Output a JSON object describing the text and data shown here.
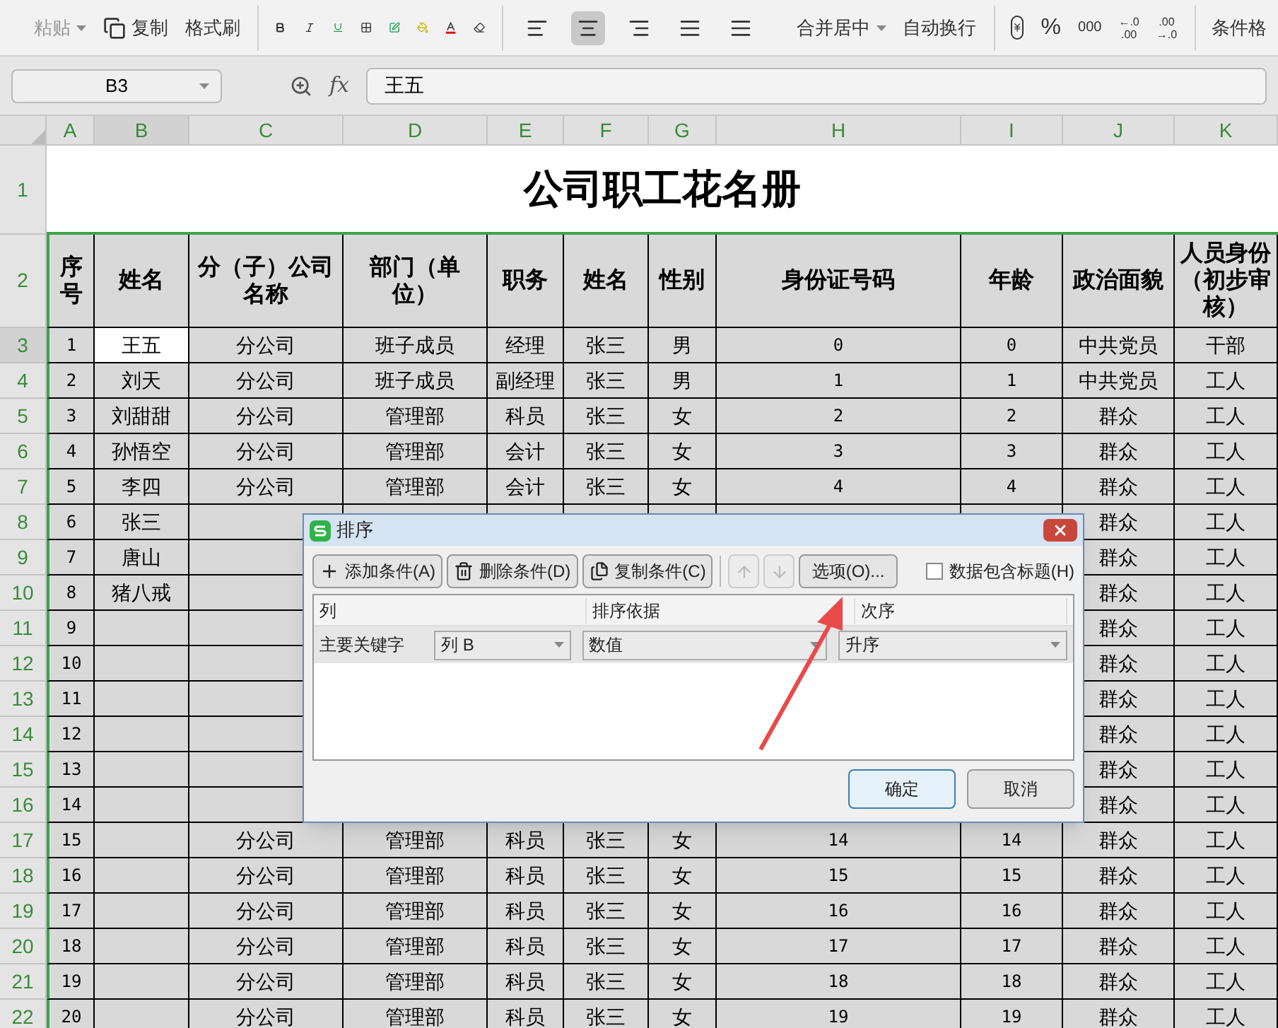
{
  "ribbon": {
    "paste": "粘贴",
    "copy": "复制",
    "format_painter": "格式刷",
    "alignment": [
      {
        "kind": "left",
        "selected": false
      },
      {
        "kind": "center",
        "selected": true
      },
      {
        "kind": "right",
        "selected": false
      },
      {
        "kind": "justify",
        "selected": false
      },
      {
        "kind": "distributed",
        "selected": false
      }
    ],
    "merge": "合并居中",
    "wrap": "自动换行",
    "percent": "%",
    "thousands": "000",
    "decimals": [
      [
        "←.0",
        ".00"
      ],
      [
        ".00",
        "→.0"
      ]
    ],
    "conditional": "条件格"
  },
  "formula_bar": {
    "cell": "B3",
    "fx": "fx",
    "value": "王五"
  },
  "columns": [
    {
      "label": "A",
      "selected": false
    },
    {
      "label": "B",
      "selected": true
    },
    {
      "label": "C",
      "selected": false
    },
    {
      "label": "D",
      "selected": false
    },
    {
      "label": "E",
      "selected": false
    },
    {
      "label": "F",
      "selected": false
    },
    {
      "label": "G",
      "selected": false
    },
    {
      "label": "H",
      "selected": false
    },
    {
      "label": "I",
      "selected": false
    },
    {
      "label": "J",
      "selected": false
    },
    {
      "label": "K",
      "selected": false
    }
  ],
  "title_row": {
    "row": "1",
    "title": "公司职工花名册"
  },
  "header_row": {
    "row": "2",
    "cells": {
      "A": "序号",
      "B": "姓名",
      "C": "分（子）公司名称",
      "D": "部门（单位）",
      "E": "职务",
      "F": "姓名",
      "G": "性别",
      "H": "身份证号码",
      "I": "年龄",
      "J": "政治面貌",
      "K": "人员身份（初步审核）"
    }
  },
  "rows": [
    {
      "row": "3",
      "selected": true,
      "cells": {
        "A": "1",
        "B": "王五",
        "C": "分公司",
        "D": "班子成员",
        "E": "经理",
        "F": "张三",
        "G": "男",
        "H": "0",
        "I": "0",
        "J": "中共党员",
        "K": "干部"
      }
    },
    {
      "row": "4",
      "selected": false,
      "cells": {
        "A": "2",
        "B": "刘天",
        "C": "分公司",
        "D": "班子成员",
        "E": "副经理",
        "F": "张三",
        "G": "男",
        "H": "1",
        "I": "1",
        "J": "中共党员",
        "K": "工人"
      }
    },
    {
      "row": "5",
      "selected": false,
      "cells": {
        "A": "3",
        "B": "刘甜甜",
        "C": "分公司",
        "D": "管理部",
        "E": "科员",
        "F": "张三",
        "G": "女",
        "H": "2",
        "I": "2",
        "J": "群众",
        "K": "工人"
      }
    },
    {
      "row": "6",
      "selected": false,
      "cells": {
        "A": "4",
        "B": "孙悟空",
        "C": "分公司",
        "D": "管理部",
        "E": "会计",
        "F": "张三",
        "G": "女",
        "H": "3",
        "I": "3",
        "J": "群众",
        "K": "工人"
      }
    },
    {
      "row": "7",
      "selected": false,
      "cells": {
        "A": "5",
        "B": "李四",
        "C": "分公司",
        "D": "管理部",
        "E": "会计",
        "F": "张三",
        "G": "女",
        "H": "4",
        "I": "4",
        "J": "群众",
        "K": "工人"
      }
    },
    {
      "row": "8",
      "selected": false,
      "cells": {
        "A": "6",
        "B": "张三",
        "J": "群众",
        "K": "工人"
      }
    },
    {
      "row": "9",
      "selected": false,
      "cells": {
        "A": "7",
        "B": "唐山",
        "J": "群众",
        "K": "工人"
      }
    },
    {
      "row": "10",
      "selected": false,
      "cells": {
        "A": "8",
        "B": "猪八戒",
        "J": "群众",
        "K": "工人"
      }
    },
    {
      "row": "11",
      "selected": false,
      "cells": {
        "A": "9",
        "J": "群众",
        "K": "工人"
      }
    },
    {
      "row": "12",
      "selected": false,
      "cells": {
        "A": "10",
        "J": "群众",
        "K": "工人"
      }
    },
    {
      "row": "13",
      "selected": false,
      "cells": {
        "A": "11",
        "J": "群众",
        "K": "工人"
      }
    },
    {
      "row": "14",
      "selected": false,
      "cells": {
        "A": "12",
        "J": "群众",
        "K": "工人"
      }
    },
    {
      "row": "15",
      "selected": false,
      "cells": {
        "A": "13",
        "J": "群众",
        "K": "工人"
      }
    },
    {
      "row": "16",
      "selected": false,
      "cells": {
        "A": "14",
        "J": "群众",
        "K": "工人"
      }
    },
    {
      "row": "17",
      "selected": false,
      "cells": {
        "A": "15",
        "C": "分公司",
        "D": "管理部",
        "E": "科员",
        "F": "张三",
        "G": "女",
        "H": "14",
        "I": "14",
        "J": "群众",
        "K": "工人"
      }
    },
    {
      "row": "18",
      "selected": false,
      "cells": {
        "A": "16",
        "C": "分公司",
        "D": "管理部",
        "E": "科员",
        "F": "张三",
        "G": "女",
        "H": "15",
        "I": "15",
        "J": "群众",
        "K": "工人"
      }
    },
    {
      "row": "19",
      "selected": false,
      "cells": {
        "A": "17",
        "C": "分公司",
        "D": "管理部",
        "E": "科员",
        "F": "张三",
        "G": "女",
        "H": "16",
        "I": "16",
        "J": "群众",
        "K": "工人"
      }
    },
    {
      "row": "20",
      "selected": false,
      "cells": {
        "A": "18",
        "C": "分公司",
        "D": "管理部",
        "E": "科员",
        "F": "张三",
        "G": "女",
        "H": "17",
        "I": "17",
        "J": "群众",
        "K": "工人"
      }
    },
    {
      "row": "21",
      "selected": false,
      "cells": {
        "A": "19",
        "C": "分公司",
        "D": "管理部",
        "E": "科员",
        "F": "张三",
        "G": "女",
        "H": "18",
        "I": "18",
        "J": "群众",
        "K": "工人"
      }
    },
    {
      "row": "22",
      "selected": false,
      "cells": {
        "A": "20",
        "C": "分公司",
        "D": "管理部",
        "E": "科员",
        "F": "张三",
        "G": "女",
        "H": "19",
        "I": "19",
        "J": "群众",
        "K": "工人"
      }
    }
  ],
  "dialog": {
    "title": "排序",
    "buttons": [
      {
        "label": "添加条件(A)",
        "kind": "add"
      },
      {
        "label": "删除条件(D)",
        "kind": "delete"
      },
      {
        "label": "复制条件(C)",
        "kind": "copy"
      }
    ],
    "move_buttons": [
      {
        "kind": "up",
        "disabled": true
      },
      {
        "kind": "down",
        "disabled": true
      }
    ],
    "options_button": "选项(O)...",
    "header_checkbox": {
      "label": "数据包含标题(H)",
      "checked": false
    },
    "grid": {
      "columns": [
        "列",
        "排序依据",
        "次序"
      ],
      "rows": [
        {
          "label": "主要关键字",
          "column": "列 B",
          "basis": "数值",
          "order": "升序"
        }
      ]
    },
    "footer_buttons": [
      {
        "label": "确定",
        "kind": "primary"
      },
      {
        "label": "取消",
        "kind": "secondary"
      }
    ]
  }
}
